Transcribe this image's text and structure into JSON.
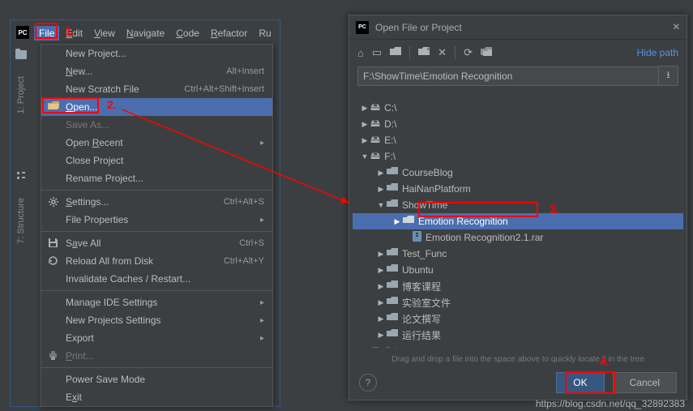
{
  "menubar": {
    "file": {
      "mn": "F",
      "rest": "ile"
    },
    "edit": {
      "mn": "E",
      "rest": "dit"
    },
    "view": {
      "mn": "V",
      "rest": "iew"
    },
    "navigate": {
      "mn": "N",
      "rest": "avigate"
    },
    "code": {
      "mn": "C",
      "rest": "ode"
    },
    "refactor": {
      "mn": "R",
      "rest": "efactor"
    },
    "run": "Ru"
  },
  "sidebar": {
    "project": "1: Project",
    "structure": "7: Structure"
  },
  "fileMenu": {
    "new_project": "New Project...",
    "new": {
      "mn": "N",
      "rest": "ew...",
      "shortcut": "Alt+Insert"
    },
    "new_scratch": {
      "label": "New Scratch File",
      "shortcut": "Ctrl+Alt+Shift+Insert"
    },
    "open": {
      "mn": "O",
      "rest": "pen..."
    },
    "save_as": {
      "label": "Save As..."
    },
    "open_recent": {
      "pre": "Open ",
      "mn": "R",
      "rest": "ecent"
    },
    "close_project": {
      "pre": "Close Pro",
      "mn": "j",
      "rest": "ect"
    },
    "rename_project": "Rename Project...",
    "settings": {
      "mn": "S",
      "rest": "ettings...",
      "shortcut": "Ctrl+Alt+S"
    },
    "file_props": "File Properties",
    "save_all": {
      "pre": "S",
      "mn": "a",
      "rest": "ve All",
      "shortcut": "Ctrl+S"
    },
    "reload": {
      "label": "Reload All from Disk",
      "shortcut": "Ctrl+Alt+Y"
    },
    "invalidate": "Invalidate Caches / Restart...",
    "manage_ide": "Manage IDE Settings",
    "new_projects_settings": "New Projects Settings",
    "export": "Export",
    "print": {
      "mn": "P",
      "rest": "rint..."
    },
    "power_save": "Power Save Mode",
    "exit": {
      "pre": "E",
      "mn": "x",
      "rest": "it"
    }
  },
  "dialog": {
    "title": "Open File or Project",
    "hide_path": "Hide path",
    "path": "F:\\ShowTime\\Emotion Recognition",
    "hint": "Drag and drop a file into the space above to quickly locate it in the tree",
    "ok": "OK",
    "cancel": "Cancel"
  },
  "tree": {
    "c": "C:\\",
    "d": "D:\\",
    "e": "E:\\",
    "f": "F:\\",
    "courseblog": "CourseBlog",
    "hainan": "HaiNanPlatform",
    "showtime": "ShowTime",
    "emotion": "Emotion Recognition",
    "emotion_rar": "Emotion Recognition2.1.rar",
    "testfunc": "Test_Func",
    "ubuntu": "Ubuntu",
    "bokeclass": "博客课程",
    "labfiles": "实验室文件",
    "paper": "论文撰写",
    "runresult": "运行结果",
    "g": "G:\\"
  },
  "annotations": {
    "n1": "1.",
    "n2": "2.",
    "n3": "3.",
    "n4": "4."
  },
  "watermark": "https://blog.csdn.net/qq_32892383"
}
